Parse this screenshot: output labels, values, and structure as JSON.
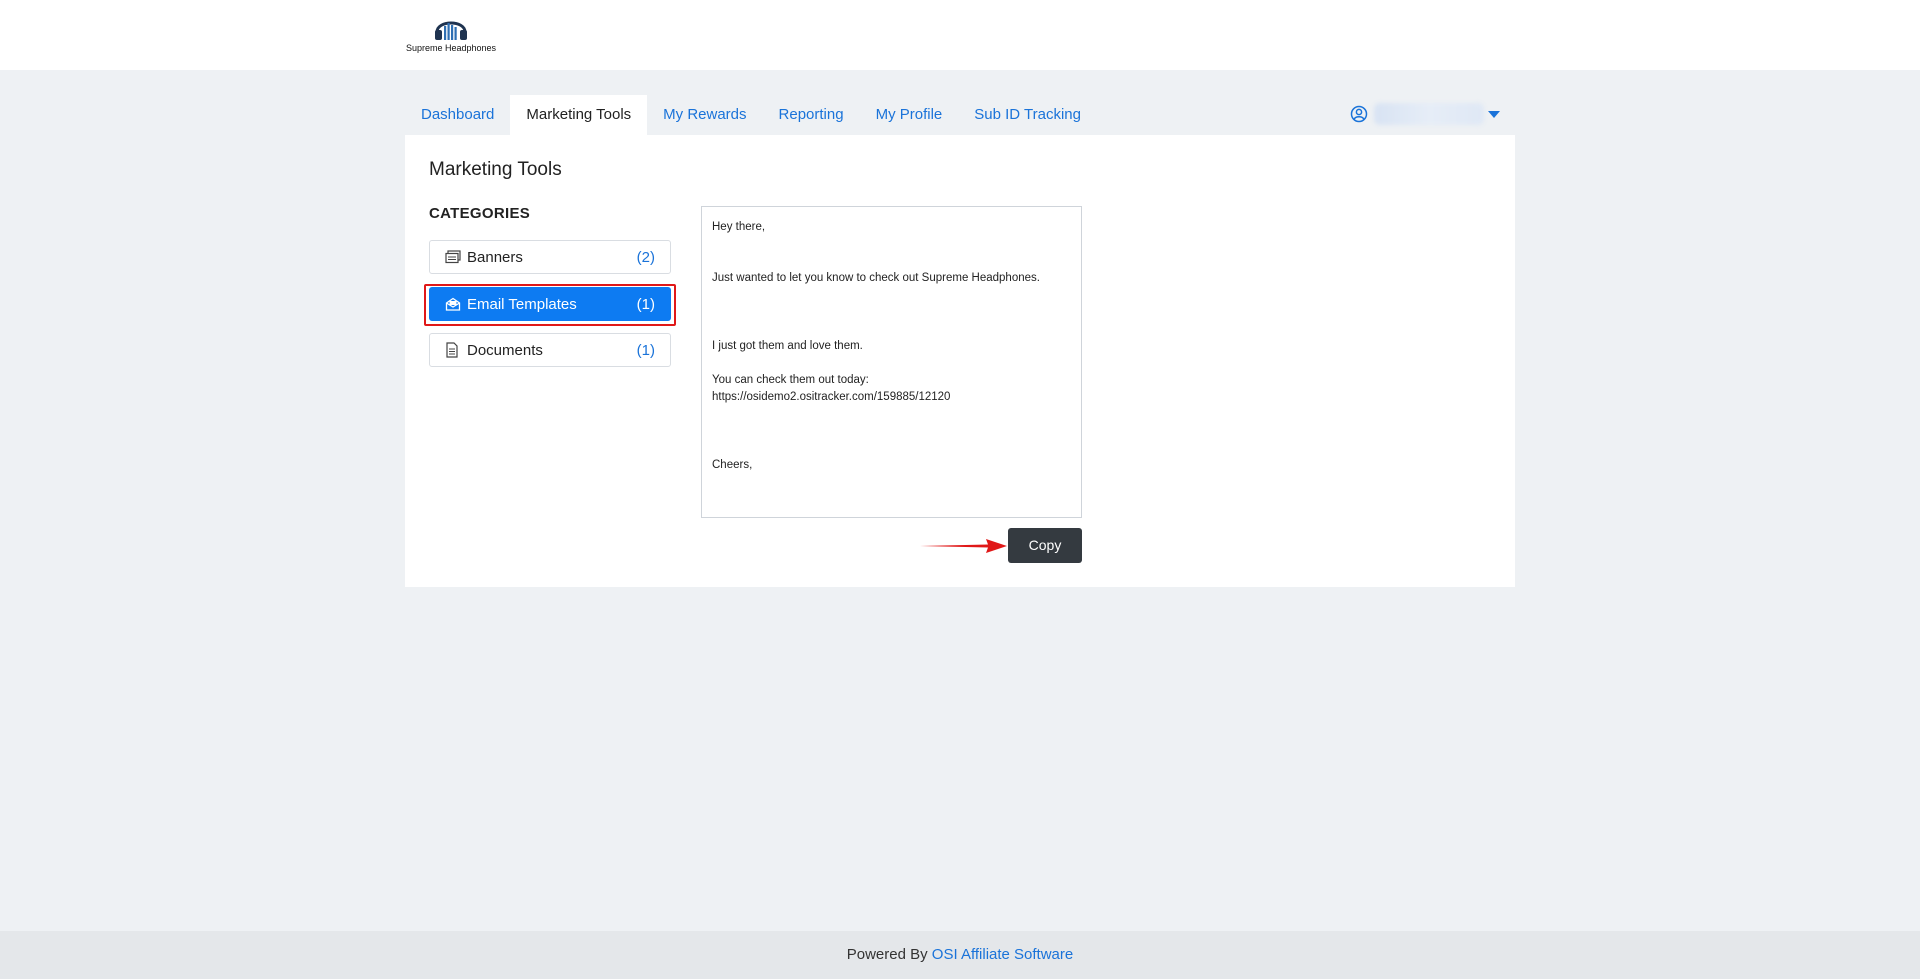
{
  "brand": {
    "name": "Supreme Headphones",
    "logo_icon": "headphones-logo",
    "logo_color": "#1f3350"
  },
  "nav": {
    "tabs": [
      {
        "label": "Dashboard",
        "active": false
      },
      {
        "label": "Marketing Tools",
        "active": true
      },
      {
        "label": "My Rewards",
        "active": false
      },
      {
        "label": "Reporting",
        "active": false
      },
      {
        "label": "My Profile",
        "active": false
      },
      {
        "label": "Sub ID Tracking",
        "active": false
      }
    ],
    "user_icon": "user-circle-icon",
    "dropdown_icon": "caret-down-icon"
  },
  "page": {
    "title": "Marketing Tools",
    "categories_heading": "CATEGORIES",
    "categories": [
      {
        "label": "Banners",
        "count": "(2)",
        "icon": "banner-icon",
        "active": false
      },
      {
        "label": "Email Templates",
        "count": "(1)",
        "icon": "envelope-open-icon",
        "active": true
      },
      {
        "label": "Documents",
        "count": "(1)",
        "icon": "document-icon",
        "active": false
      }
    ]
  },
  "email_template": {
    "lines": [
      "Hey there,",
      "",
      "Just wanted to let you know to check out Supreme Headphones.",
      "",
      "I just got them and love them.",
      "You can check them out today:",
      "https://osidemo2.ositracker.com/159885/12120",
      "",
      "Cheers,"
    ],
    "copy_label": "Copy"
  },
  "footer": {
    "prefix": "Powered By",
    "link_text": "OSI Affiliate Software"
  },
  "colors": {
    "accent": "#1a73d9",
    "active_category": "#0d7bf2",
    "copy_button": "#343a40",
    "annotation_red": "#e01818",
    "background": "#eef1f4"
  }
}
